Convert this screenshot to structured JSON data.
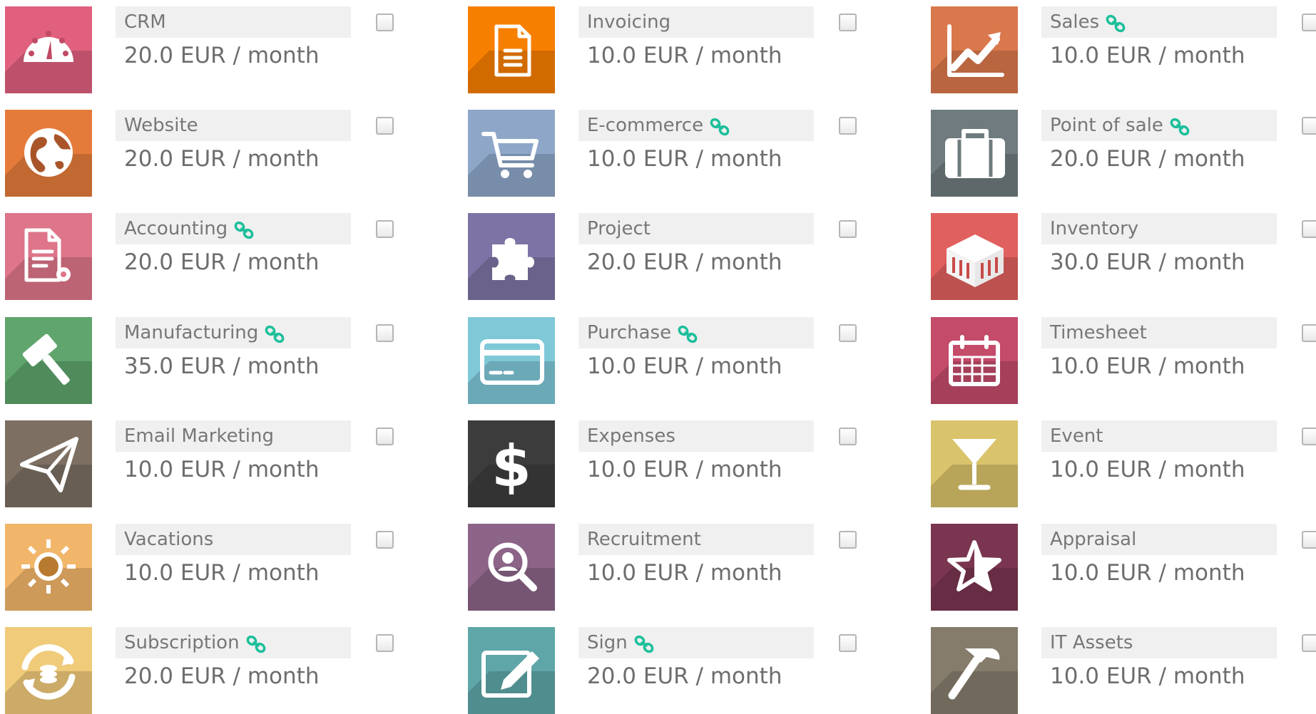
{
  "apps": [
    {
      "id": "crm",
      "name": "CRM",
      "price": "20.0 EUR / month",
      "linked": false,
      "color": "#e0607e",
      "icon": "gauge-icon"
    },
    {
      "id": "invoicing",
      "name": "Invoicing",
      "price": "10.0 EUR / month",
      "linked": false,
      "color": "#f77f00",
      "icon": "document-icon"
    },
    {
      "id": "sales",
      "name": "Sales",
      "price": "10.0 EUR / month",
      "linked": true,
      "color": "#d9784c",
      "icon": "trend-chart-icon"
    },
    {
      "id": "website",
      "name": "Website",
      "price": "20.0 EUR / month",
      "linked": false,
      "color": "#e57b3b",
      "icon": "globe-icon"
    },
    {
      "id": "ecommerce",
      "name": "E-commerce",
      "price": "10.0 EUR / month",
      "linked": true,
      "color": "#8ea6c8",
      "icon": "cart-icon"
    },
    {
      "id": "pos",
      "name": "Point of sale",
      "price": "20.0 EUR / month",
      "linked": true,
      "color": "#6f7b7e",
      "icon": "briefcase-icon"
    },
    {
      "id": "accounting",
      "name": "Accounting",
      "price": "20.0 EUR / month",
      "linked": true,
      "color": "#de7589",
      "icon": "document-gear-icon"
    },
    {
      "id": "project",
      "name": "Project",
      "price": "20.0 EUR / month",
      "linked": false,
      "color": "#7e73a5",
      "icon": "puzzle-icon"
    },
    {
      "id": "inventory",
      "name": "Inventory",
      "price": "30.0 EUR / month",
      "linked": false,
      "color": "#e0605e",
      "icon": "warehouse-icon"
    },
    {
      "id": "manufacturing",
      "name": "Manufacturing",
      "price": "35.0 EUR / month",
      "linked": true,
      "color": "#5fa56d",
      "icon": "gavel-icon"
    },
    {
      "id": "purchase",
      "name": "Purchase",
      "price": "10.0 EUR / month",
      "linked": true,
      "color": "#7fc8d8",
      "icon": "credit-card-icon"
    },
    {
      "id": "timesheet",
      "name": "Timesheet",
      "price": "10.0 EUR / month",
      "linked": false,
      "color": "#c44b6a",
      "icon": "calendar-icon"
    },
    {
      "id": "email_marketing",
      "name": "Email Marketing",
      "price": "10.0 EUR / month",
      "linked": false,
      "color": "#7d6f62",
      "icon": "paper-plane-icon"
    },
    {
      "id": "expenses",
      "name": "Expenses",
      "price": "10.0 EUR / month",
      "linked": false,
      "color": "#3c3c3c",
      "icon": "dollar-icon"
    },
    {
      "id": "event",
      "name": "Event",
      "price": "10.0 EUR / month",
      "linked": false,
      "color": "#d9c46b",
      "icon": "cocktail-glass-icon"
    },
    {
      "id": "vacations",
      "name": "Vacations",
      "price": "10.0 EUR / month",
      "linked": false,
      "color": "#f2b66a",
      "icon": "sun-icon"
    },
    {
      "id": "recruitment",
      "name": "Recruitment",
      "price": "10.0 EUR / month",
      "linked": false,
      "color": "#8c6487",
      "icon": "search-person-icon"
    },
    {
      "id": "appraisal",
      "name": "Appraisal",
      "price": "10.0 EUR / month",
      "linked": false,
      "color": "#7a3550",
      "icon": "star-icon"
    },
    {
      "id": "subscription",
      "name": "Subscription",
      "price": "20.0 EUR / month",
      "linked": true,
      "color": "#f0cb7a",
      "icon": "recurring-coins-icon"
    },
    {
      "id": "sign",
      "name": "Sign",
      "price": "20.0 EUR / month",
      "linked": true,
      "color": "#5fa6a8",
      "icon": "edit-pencil-icon"
    },
    {
      "id": "it_assets",
      "name": "IT Assets",
      "price": "10.0 EUR / month",
      "linked": false,
      "color": "#857c6c",
      "icon": "hammer-icon"
    }
  ],
  "colors": {
    "link": "#1bbf9a",
    "label_bg": "#f0f0f0",
    "label_text": "#777777"
  }
}
